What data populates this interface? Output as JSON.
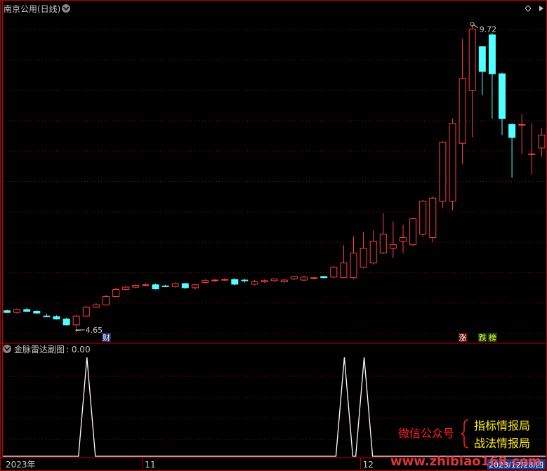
{
  "main_panel": {
    "title": "南京公用(日线)",
    "high_label": "9.72",
    "low_label": "4.65",
    "badges": [
      {
        "text": "财",
        "bg": "#1a2a6a",
        "fg": "#ffffff",
        "index": 10
      },
      {
        "text": "涨",
        "bg": "#5a1010",
        "fg": "#ffffff",
        "index": 46
      },
      {
        "text": "跌",
        "bg": "#103a10",
        "fg": "#ffff33",
        "index": 48
      },
      {
        "text": "榜",
        "bg": "#103a10",
        "fg": "#ffff33",
        "index": 49
      }
    ]
  },
  "sub_panel": {
    "title": "金脉雷达副图",
    "value_label": ": 0.00"
  },
  "x_axis": {
    "labels": [
      {
        "text": "2023年",
        "index": 0
      },
      {
        "text": "11",
        "index": 14
      },
      {
        "text": "12",
        "index": 36
      }
    ],
    "date_box": "2023/12/28/四"
  },
  "watermark": {
    "wechat_label": "微信公众号",
    "line1": "指标情报局",
    "line2": "战法情报局",
    "site": "www.zhibiao168.com"
  },
  "colors": {
    "up": "#ff4040",
    "down": "#54ffff",
    "frame": "#c00000",
    "grid": "#7a1010",
    "text": "#c8c8c8",
    "signal": "#ffffff"
  },
  "chart_data": [
    {
      "type": "candlestick",
      "title": "南京公用(日线)",
      "ylim": [
        4.4,
        9.95
      ],
      "x": [
        "1",
        "2",
        "3",
        "4",
        "5",
        "6",
        "7",
        "8",
        "9",
        "10",
        "11",
        "12",
        "13",
        "14",
        "15",
        "16",
        "17",
        "18",
        "19",
        "20",
        "21",
        "22",
        "23",
        "24",
        "25",
        "26",
        "27",
        "28",
        "29",
        "30",
        "31",
        "32",
        "33",
        "34",
        "35",
        "36",
        "37",
        "38",
        "39",
        "40",
        "41",
        "42",
        "43",
        "44",
        "45",
        "46",
        "47",
        "48",
        "49",
        "50",
        "51",
        "52",
        "53",
        "54",
        "55",
        "56"
      ],
      "series": [
        {
          "open": [
            4.94,
            4.91,
            4.96,
            4.93,
            4.85,
            4.84,
            4.8,
            4.7,
            4.85,
            5.0,
            5.04,
            5.18,
            5.3,
            5.34,
            5.37,
            5.38,
            5.36,
            5.35,
            5.4,
            5.33,
            5.42,
            5.45,
            5.46,
            5.47,
            5.46,
            5.39,
            5.43,
            5.45,
            5.43,
            5.48,
            5.46,
            5.5,
            5.52,
            5.51,
            5.5,
            5.5,
            5.68,
            5.75,
            5.92,
            6.0,
            6.12,
            6.06,
            6.24,
            6.18,
            6.8,
            6.8,
            7.78,
            8.68,
            9.42,
            9.62,
            8.96,
            8.1,
            8.1,
            7.6,
            7.7,
            7.7
          ],
          "close": [
            4.91,
            4.96,
            4.93,
            4.9,
            4.84,
            4.8,
            4.7,
            4.85,
            5.0,
            5.04,
            5.18,
            5.3,
            5.34,
            5.37,
            5.38,
            5.31,
            5.35,
            5.4,
            5.33,
            5.38,
            5.45,
            5.46,
            5.47,
            5.39,
            5.45,
            5.43,
            5.45,
            5.48,
            5.46,
            5.52,
            5.51,
            5.5,
            5.5,
            5.68,
            5.75,
            5.92,
            6.0,
            6.12,
            6.24,
            6.06,
            6.18,
            6.5,
            6.8,
            6.85,
            7.8,
            8.12,
            8.88,
            9.72,
            9.0,
            8.96,
            8.2,
            7.88,
            8.1,
            7.6,
            7.92,
            7.71
          ],
          "high": [
            4.96,
            4.98,
            4.99,
            4.95,
            4.89,
            4.86,
            4.82,
            4.87,
            5.03,
            5.07,
            5.21,
            5.33,
            5.36,
            5.39,
            5.41,
            5.4,
            5.38,
            5.42,
            5.41,
            5.4,
            5.48,
            5.48,
            5.49,
            5.49,
            5.48,
            5.46,
            5.47,
            5.49,
            5.48,
            5.53,
            5.53,
            5.51,
            5.53,
            5.7,
            6.05,
            6.2,
            6.28,
            6.3,
            6.6,
            6.45,
            6.4,
            6.52,
            6.82,
            6.88,
            7.82,
            8.2,
            9.55,
            9.8,
            9.42,
            9.65,
            8.98,
            8.12,
            8.28,
            8.12,
            8.04,
            7.96
          ],
          "low": [
            4.9,
            4.89,
            4.92,
            4.89,
            4.83,
            4.79,
            4.69,
            4.65,
            4.84,
            4.99,
            5.03,
            5.17,
            5.29,
            5.32,
            5.35,
            5.3,
            5.34,
            5.33,
            5.31,
            5.3,
            5.4,
            5.43,
            5.44,
            5.37,
            5.42,
            5.37,
            5.41,
            5.43,
            5.41,
            5.46,
            5.44,
            5.47,
            5.49,
            5.49,
            5.49,
            5.48,
            5.66,
            5.72,
            5.9,
            5.84,
            5.92,
            6.04,
            6.2,
            6.1,
            6.68,
            6.65,
            7.42,
            7.88,
            8.6,
            8.2,
            7.92,
            7.2,
            7.6,
            7.25,
            7.55,
            7.55
          ]
        }
      ]
    },
    {
      "type": "line",
      "title": "金脉雷达副图",
      "ylim": [
        0,
        1
      ],
      "x": [
        "1",
        "2",
        "3",
        "4",
        "5",
        "6",
        "7",
        "8",
        "9",
        "10",
        "11",
        "12",
        "13",
        "14",
        "15",
        "16",
        "17",
        "18",
        "19",
        "20",
        "21",
        "22",
        "23",
        "24",
        "25",
        "26",
        "27",
        "28",
        "29",
        "30",
        "31",
        "32",
        "33",
        "34",
        "35",
        "36",
        "37",
        "38",
        "39",
        "40",
        "41",
        "42",
        "43",
        "44",
        "45",
        "46",
        "47",
        "48",
        "49",
        "50",
        "51",
        "52",
        "53",
        "54",
        "55",
        "56"
      ],
      "series": [
        {
          "values": [
            0,
            0,
            0,
            0,
            0,
            0,
            0,
            0,
            1,
            0,
            0,
            0,
            0,
            0,
            0,
            0,
            0,
            0,
            0,
            0,
            0,
            0,
            0,
            0,
            0,
            0,
            0,
            0,
            0,
            0,
            0,
            0,
            0,
            0,
            1,
            0,
            1,
            0,
            0,
            0,
            0,
            0,
            0,
            0,
            0,
            0,
            0,
            0,
            0,
            0,
            0,
            0,
            0,
            0,
            0,
            0
          ]
        }
      ]
    }
  ]
}
